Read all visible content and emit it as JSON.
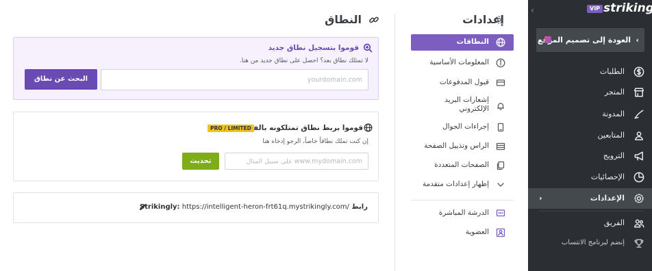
{
  "sidebar": {
    "vip": "VIP",
    "brand": "strikingly",
    "back_label": "العودة إلى تصميم الموقع",
    "items": [
      {
        "label": "الطلبات",
        "icon": "dollar-icon"
      },
      {
        "label": "المتجر",
        "icon": "store-icon"
      },
      {
        "label": "المدونة",
        "icon": "pen-icon"
      },
      {
        "label": "المتابعين",
        "icon": "users-icon"
      },
      {
        "label": "الترويج",
        "icon": "megaphone-icon"
      },
      {
        "label": "الإحصائيات",
        "icon": "pie-chart-icon"
      },
      {
        "label": "الإعدادات",
        "icon": "gear-icon"
      },
      {
        "label": "الفريق",
        "icon": "team-icon"
      },
      {
        "label": "إنضم لبرنامج الانتساب",
        "icon": "trophy-icon"
      }
    ],
    "active_index": 6
  },
  "settings_nav": {
    "title": "إعدادات",
    "items": [
      {
        "label": "النطاقات",
        "icon": "globe-icon"
      },
      {
        "label": "المعلومات الأساسية",
        "icon": "info-icon"
      },
      {
        "label": "قبول المدفوعات",
        "icon": "card-icon"
      },
      {
        "label": "إشعارات البريد الإلكتروني",
        "icon": "bell-icon"
      },
      {
        "label": "إجراءات الجوال",
        "icon": "mobile-icon"
      },
      {
        "label": "الراس وتذييل الصفحة",
        "icon": "layout-icon"
      },
      {
        "label": "الصفحات المتعددة",
        "icon": "pages-icon"
      },
      {
        "label": "إظهار إعدادات متقدمة",
        "icon": "chevron-down-icon"
      },
      {
        "label": "الدرشة المباشرة",
        "icon": "chat-icon"
      },
      {
        "label": "العضوية",
        "icon": "member-icon"
      }
    ],
    "active_index": 0
  },
  "main": {
    "title": "النطاق",
    "register": {
      "heading": "قوموا بتسجيل نطاق جديد",
      "sub": "لا تمتلك نطاق بعد؟ احصل على نطاق جديد من هنا.",
      "placeholder": "yourdomain.com",
      "button": "البحث عن نطاق"
    },
    "connect": {
      "heading": "قوموا بربط نطاق تمتلكونه بالفعل",
      "badge": "PRO / LIMITED",
      "sub": "إن كنت تملك نطاقاً خاصاً، الرجو إدخاه هنا",
      "placeholder": "على سبيل المثال www.mydomain.com",
      "button": "تحديث"
    },
    "link": {
      "label": "رابط Strikingly:",
      "url": "https://intelligent-heron-frt61q.mystrikingly.com/"
    }
  },
  "colors": {
    "sidebar_bg": "#2b2f33",
    "accent": "#7b5ec0",
    "button_purple": "#6a4bb3",
    "button_green": "#7fad1a",
    "badge_yellow": "#f3c21d"
  }
}
